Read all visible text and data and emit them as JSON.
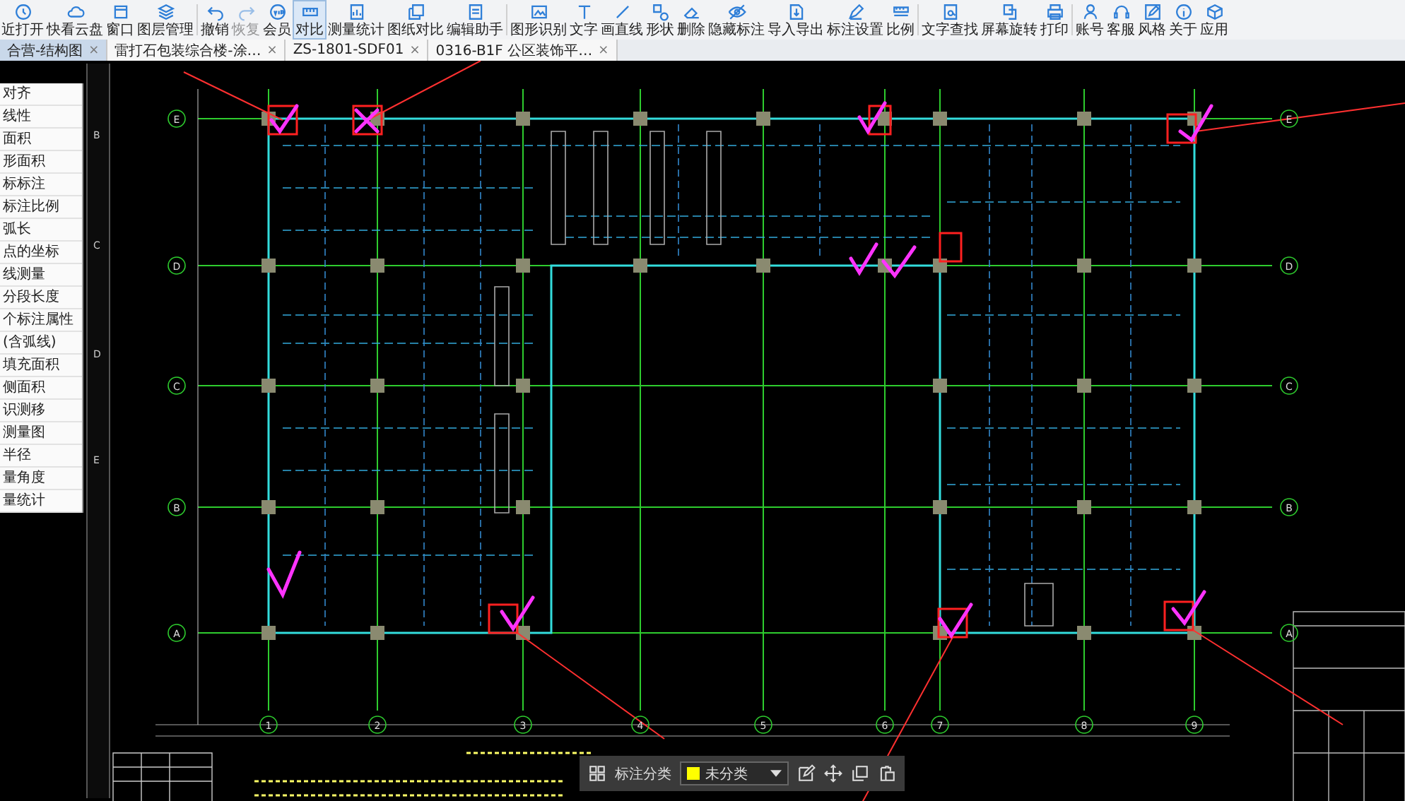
{
  "toolbar": {
    "items": [
      {
        "label": "近打开",
        "selected": false,
        "disabled": false,
        "divider_after": false
      },
      {
        "label": "快看云盘",
        "selected": false,
        "disabled": false,
        "divider_after": false
      },
      {
        "label": "窗口",
        "selected": false,
        "disabled": false,
        "divider_after": false
      },
      {
        "label": "图层管理",
        "selected": false,
        "disabled": false,
        "divider_after": true
      },
      {
        "label": "撤销",
        "selected": false,
        "disabled": false,
        "divider_after": false
      },
      {
        "label": "恢复",
        "selected": false,
        "disabled": true,
        "divider_after": false
      },
      {
        "label": "会员",
        "selected": false,
        "disabled": false,
        "divider_after": false
      },
      {
        "label": "对比",
        "selected": true,
        "disabled": false,
        "divider_after": false
      },
      {
        "label": "测量统计",
        "selected": false,
        "disabled": false,
        "divider_after": false
      },
      {
        "label": "图纸对比",
        "selected": false,
        "disabled": false,
        "divider_after": false
      },
      {
        "label": "编辑助手",
        "selected": false,
        "disabled": false,
        "divider_after": true
      },
      {
        "label": "图形识别",
        "selected": false,
        "disabled": false,
        "divider_after": false
      },
      {
        "label": "文字",
        "selected": false,
        "disabled": false,
        "divider_after": false
      },
      {
        "label": "画直线",
        "selected": false,
        "disabled": false,
        "divider_after": false
      },
      {
        "label": "形状",
        "selected": false,
        "disabled": false,
        "divider_after": false
      },
      {
        "label": "删除",
        "selected": false,
        "disabled": false,
        "divider_after": false
      },
      {
        "label": "隐藏标注",
        "selected": false,
        "disabled": false,
        "divider_after": false
      },
      {
        "label": "导入导出",
        "selected": false,
        "disabled": false,
        "divider_after": false
      },
      {
        "label": "标注设置",
        "selected": false,
        "disabled": false,
        "divider_after": false
      },
      {
        "label": "比例",
        "selected": false,
        "disabled": false,
        "divider_after": true
      },
      {
        "label": "文字查找",
        "selected": false,
        "disabled": false,
        "divider_after": false
      },
      {
        "label": "屏幕旋转",
        "selected": false,
        "disabled": false,
        "divider_after": false
      },
      {
        "label": "打印",
        "selected": false,
        "disabled": false,
        "divider_after": true
      },
      {
        "label": "账号",
        "selected": false,
        "disabled": false,
        "divider_after": false
      },
      {
        "label": "客服",
        "selected": false,
        "disabled": false,
        "divider_after": false
      },
      {
        "label": "风格",
        "selected": false,
        "disabled": false,
        "divider_after": false
      },
      {
        "label": "关于",
        "selected": false,
        "disabled": false,
        "divider_after": false
      },
      {
        "label": "应用",
        "selected": false,
        "disabled": false,
        "divider_after": false
      }
    ]
  },
  "tabs": [
    {
      "label": "合营-结构图",
      "selected": true,
      "close": "×"
    },
    {
      "label": "雷打石包装综合楼-涂…",
      "selected": false,
      "close": "×"
    },
    {
      "label": "ZS-1801-SDF01",
      "selected": false,
      "close": "×"
    },
    {
      "label": "0316-B1F 公区装饰平…",
      "selected": false,
      "close": "×"
    }
  ],
  "sidebar": {
    "items": [
      "对齐",
      "线性",
      "面积",
      "形面积",
      "标标注",
      "标注比例",
      "弧长",
      "点的坐标",
      "线测量",
      "分段长度",
      "个标注属性",
      "(含弧线)",
      "填充面积",
      "侧面积",
      "识测移",
      "测量图",
      "半径",
      "量角度",
      "量统计"
    ]
  },
  "ruler_labels": [
    "B",
    "C",
    "D",
    "E"
  ],
  "drawing": {
    "row_axes_left": [
      "E",
      "D",
      "C",
      "B",
      "A"
    ],
    "row_axes_right": [
      "E",
      "D",
      "C",
      "B",
      "A"
    ],
    "column_axes": [
      "1",
      "2",
      "3",
      "4",
      "5",
      "6",
      "7",
      "8",
      "9"
    ]
  },
  "annotation_bar": {
    "label": "标注分类",
    "category": {
      "name": "未分类",
      "color": "#ffff00"
    }
  }
}
